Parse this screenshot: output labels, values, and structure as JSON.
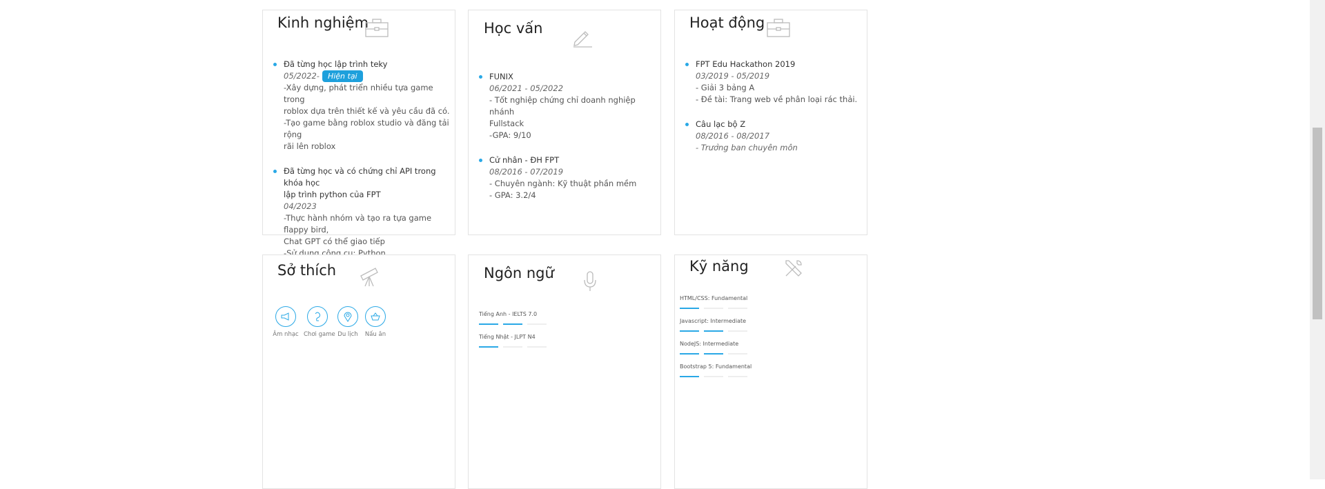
{
  "experience": {
    "title": "Kinh nghiệm",
    "icon": "briefcase-icon",
    "entries": [
      {
        "title": "Đã từng học lập trình teky",
        "date": "05/2022-",
        "badge": "Hiện tại",
        "lines": [
          "-Xây dựng, phát triển nhiều tựa game trong",
          "roblox dựa trên thiết kế và yêu cầu đã có.",
          "-Tạo game bằng roblox studio và đăng tải rộng",
          "rãi lên roblox"
        ]
      },
      {
        "title_lines": [
          "Đã từng học và có chứng chỉ API trong khóa học",
          "lập trình python của FPT"
        ],
        "date": "04/2023",
        "lines": [
          "-Thực hành nhóm và tạo ra tựa game flappy bird,",
          "Chat GPT có thể giao tiếp",
          "-Sử dụng công cụ: Python."
        ]
      }
    ]
  },
  "education": {
    "title": "Học vấn",
    "icon": "pencil-icon",
    "entries": [
      {
        "title": "FUNIX",
        "date": "06/2021 - 05/2022",
        "lines": [
          "- Tốt nghiệp chứng chỉ doanh nghiệp nhánh",
          "Fullstack",
          "-GPA: 9/10"
        ]
      },
      {
        "title": "Cử nhân - ĐH FPT",
        "date": "08/2016 - 07/2019",
        "lines": [
          "- Chuyên ngành: Kỹ thuật phần mềm",
          "- GPA: 3.2/4"
        ]
      }
    ]
  },
  "activities": {
    "title": "Hoạt động",
    "icon": "briefcase-icon",
    "entries": [
      {
        "title": "FPT Edu Hackathon 2019",
        "date": "03/2019 - 05/2019",
        "lines": [
          "- Giải 3 bảng A",
          "- Đề tài: Trang web về phân loại rác thải."
        ]
      },
      {
        "title": "Câu lạc bộ Z",
        "date": "08/2016 - 08/2017",
        "note": "- Trưởng ban chuyên môn"
      }
    ]
  },
  "hobbies": {
    "title": "Sở thích",
    "icon": "telescope-icon",
    "items": [
      {
        "label": "Âm nhạc",
        "icon": "megaphone-icon"
      },
      {
        "label": "Chơi game",
        "icon": "game-icon"
      },
      {
        "label": "Du lịch",
        "icon": "location-pin-icon"
      },
      {
        "label": "Nấu ăn",
        "icon": "basket-icon"
      }
    ]
  },
  "languages": {
    "title": "Ngôn ngữ",
    "icon": "microphone-icon",
    "items": [
      {
        "label": "Tiếng Anh - IELTS 7.0",
        "level": 2,
        "max": 3
      },
      {
        "label": "Tiếng Nhật - JLPT N4",
        "level": 1,
        "max": 3
      }
    ]
  },
  "skills": {
    "title": "Kỹ năng",
    "icon": "tools-icon",
    "items": [
      {
        "label": "HTML/CSS: Fundamental",
        "level": 1,
        "max": 3
      },
      {
        "label": "Javascript: Intermediate",
        "level": 2,
        "max": 3
      },
      {
        "label": "NodeJS: Intermediate",
        "level": 2,
        "max": 3
      },
      {
        "label": "Bootstrap 5: Fundamental",
        "level": 1,
        "max": 3
      }
    ]
  },
  "colors": {
    "accent": "#29a8e6",
    "badge": "#1ea0dc",
    "border": "#e3e3e3"
  }
}
